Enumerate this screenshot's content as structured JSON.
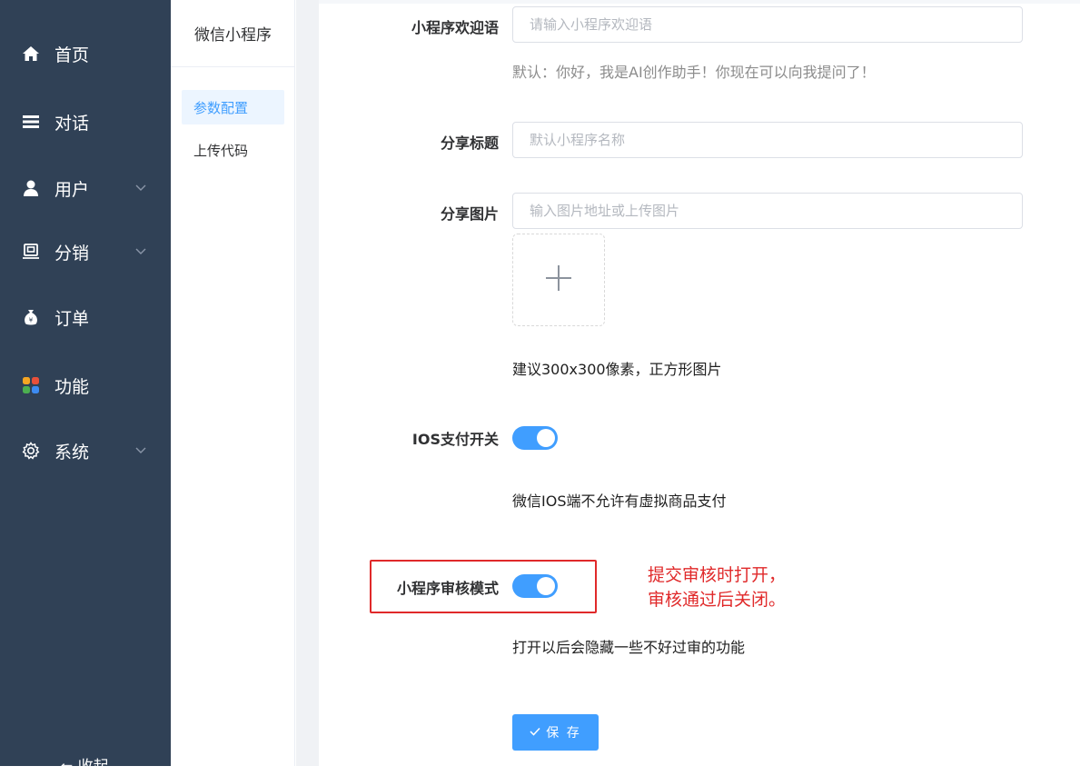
{
  "sidebar": {
    "items": [
      {
        "label": "首页",
        "icon": "home-icon"
      },
      {
        "label": "对话",
        "icon": "menu-lines-icon"
      },
      {
        "label": "用户",
        "icon": "user-icon",
        "expandable": true
      },
      {
        "label": "分销",
        "icon": "distribution-icon",
        "expandable": true
      },
      {
        "label": "订单",
        "icon": "money-bag-icon"
      },
      {
        "label": "功能",
        "icon": "apps-grid-icon"
      },
      {
        "label": "系统",
        "icon": "gear-icon",
        "expandable": true
      }
    ],
    "collapse_label": "收起"
  },
  "subpanel": {
    "title": "微信小程序",
    "items": [
      {
        "label": "参数配置",
        "active": true
      },
      {
        "label": "上传代码",
        "active": false
      }
    ]
  },
  "form": {
    "welcome": {
      "label": "小程序欢迎语",
      "placeholder": "请输入小程序欢迎语",
      "hint": "默认：你好，我是AI创作助手！你现在可以向我提问了！"
    },
    "share_title": {
      "label": "分享标题",
      "placeholder": "默认小程序名称"
    },
    "share_image": {
      "label": "分享图片",
      "placeholder": "输入图片地址或上传图片",
      "hint": "建议300x300像素，正方形图片"
    },
    "ios_pay": {
      "label": "IOS支付开关",
      "enabled": true,
      "hint": "微信IOS端不允许有虚拟商品支付"
    },
    "review_mode": {
      "label": "小程序审核模式",
      "enabled": true,
      "hint": "打开以后会隐藏一些不好过审的功能"
    },
    "save_label": "保 存"
  },
  "annotation": {
    "line1": "提交审核时打开，",
    "line2": "审核通过后关闭。"
  },
  "colors": {
    "sidebar_bg": "#304156",
    "accent": "#409eff",
    "annotation_red": "#e0292a"
  }
}
